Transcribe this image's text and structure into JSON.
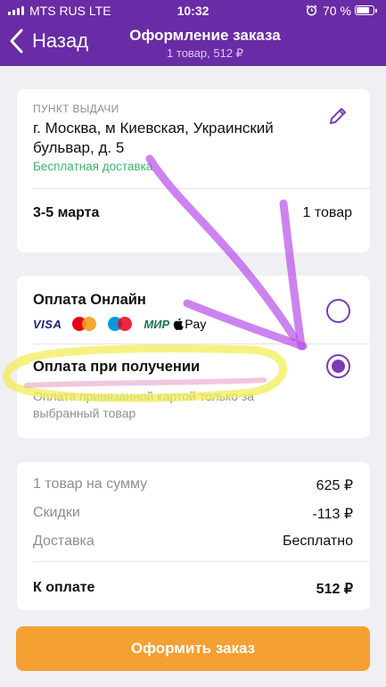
{
  "status_bar": {
    "carrier": "MTS RUS  LTE",
    "time": "10:32",
    "battery": "70 %",
    "battery_level": 0.7,
    "icons": [
      "signal-icon",
      "alarm-icon",
      "battery-icon"
    ]
  },
  "nav": {
    "back_label": "Назад",
    "title": "Оформление заказа",
    "subtitle": "1 товар, 512 ₽"
  },
  "delivery": {
    "label": "ПУНКТ ВЫДАЧИ",
    "address": "г. Москва, м Киевская, Украинский бульвар, д. 5",
    "free_delivery": "Бесплатная доставка",
    "dates": "3-5 марта",
    "quantity": "1 товар"
  },
  "payment": {
    "online": {
      "title": "Оплата Онлайн",
      "selected": false,
      "logos": {
        "visa": "VISA",
        "mir": "МИР",
        "apple_pay": "Pay"
      }
    },
    "on_delivery": {
      "title": "Оплата при получении",
      "selected": true,
      "description": "Оплата привязанной картой только за выбранный товар"
    }
  },
  "summary": {
    "items": {
      "label": "1 товар на сумму",
      "value": "625 ₽"
    },
    "discount": {
      "label": "Скидки",
      "value": "-113 ₽"
    },
    "delivery": {
      "label": "Доставка",
      "value": "Бесплатно"
    },
    "total": {
      "label": "К оплате",
      "value": "512 ₽"
    }
  },
  "checkout_button": "Оформить заказ",
  "colors": {
    "brand": "#6a2ba6",
    "accent": "#7a3bb8",
    "success": "#3cb46e",
    "cta": "#f5a033",
    "annotation_arrow": "#b84ee8",
    "annotation_highlight": "#f2ee5a"
  }
}
